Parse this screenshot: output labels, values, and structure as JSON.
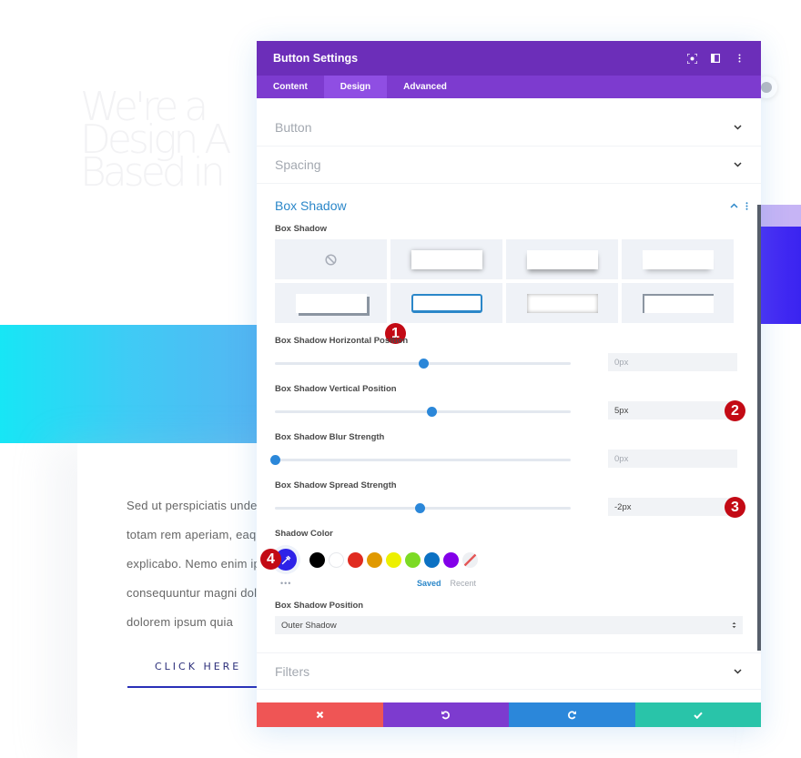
{
  "background": {
    "heading_lines": [
      "We're a",
      "Design A",
      "Based in"
    ],
    "paragraph_lines": [
      "Sed ut perspiciatis unde",
      "totam rem aperiam, eaqu",
      "explicabo. Nemo enim ip",
      "consequuntur magni dolo",
      "dolorem ipsum quia"
    ],
    "cta_label": "CLICK HERE"
  },
  "modal": {
    "title": "Button Settings",
    "header_icons": [
      "focus-icon",
      "split-view-icon",
      "more-vertical-icon"
    ],
    "tabs": [
      {
        "label": "Content",
        "active": false
      },
      {
        "label": "Design",
        "active": true
      },
      {
        "label": "Advanced",
        "active": false
      }
    ],
    "sections": {
      "button": "Button",
      "spacing": "Spacing",
      "box_shadow": "Box Shadow",
      "filters": "Filters"
    },
    "box_shadow": {
      "preset_label": "Box Shadow",
      "presets": [
        "none",
        "shadow-all",
        "shadow-bottom",
        "shadow-soft-bottom",
        "shadow-bottom-right-offset",
        "shadow-border-selected",
        "shadow-inset",
        "shadow-top-left-offset"
      ],
      "selected_preset": 5,
      "sliders": [
        {
          "label": "Box Shadow Horizontal Position",
          "value": "0px",
          "fraction": 0.5,
          "muted": true
        },
        {
          "label": "Box Shadow Vertical Position",
          "value": "5px",
          "fraction": 0.53,
          "muted": false
        },
        {
          "label": "Box Shadow Blur Strength",
          "value": "0px",
          "fraction": 0.0,
          "muted": true
        },
        {
          "label": "Box Shadow Spread Strength",
          "value": "-2px",
          "fraction": 0.49,
          "muted": false
        }
      ],
      "shadow_color_label": "Shadow Color",
      "selected_color": "#2d22e8",
      "swatches": [
        "#000000",
        "#ffffff",
        "#e02b20",
        "#e09900",
        "#edf000",
        "#7cda24",
        "#0c71c3",
        "#8300e9",
        "none"
      ],
      "dots": "•••",
      "saved_label": "Saved",
      "recent_label": "Recent",
      "position_label": "Box Shadow Position",
      "position_value": "Outer Shadow"
    },
    "footer": {
      "cancel": {
        "icon": "close-icon",
        "color": "#ef5555"
      },
      "undo": {
        "icon": "undo-icon",
        "color": "#7d3bcf"
      },
      "redo": {
        "icon": "redo-icon",
        "color": "#2b87da"
      },
      "save": {
        "icon": "check-icon",
        "color": "#29c4a9"
      }
    }
  },
  "annotations": [
    "1",
    "2",
    "3",
    "4"
  ]
}
